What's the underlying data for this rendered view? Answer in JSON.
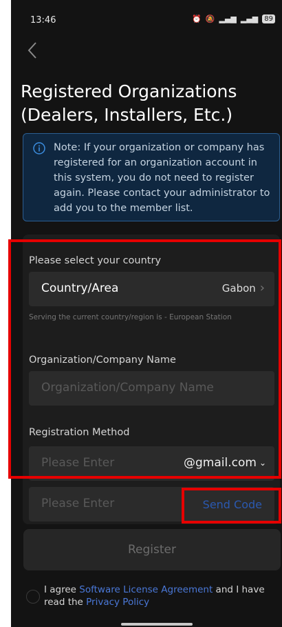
{
  "status": {
    "time": "13:46",
    "signal_a": "ᴴ¹ᴵ",
    "signal_b": "ᴴ¹ᴵ",
    "battery": "89"
  },
  "header": {
    "title": "Registered Organizations (Dealers, Installers, Etc.)"
  },
  "note": {
    "text": "Note: If your organization or company has registered for an organization account in this system, you do not need to register again. Please contact your administrator to add you to the member list."
  },
  "form": {
    "country_label": "Please select your country",
    "country_field_label": "Country/Area",
    "country_value": "Gabon",
    "country_hint": "Serving the current country/region is - European Station",
    "org_label": "Organization/Company Name",
    "org_placeholder": "Organization/Company Name",
    "method_label": "Registration Method",
    "email_placeholder": "Please Enter",
    "email_domain": "@gmail.com",
    "code_placeholder": "Please Enter",
    "send_code": "Send Code"
  },
  "actions": {
    "register": "Register"
  },
  "agreement": {
    "prefix": "I agree ",
    "license_link": "Software License Agreement",
    "middle": " and I have read the ",
    "privacy_link": "Privacy Policy"
  },
  "colors": {
    "background": "#131313",
    "field": "#2b2b2b",
    "accent": "#2b59b0",
    "highlight": "#e60000"
  }
}
